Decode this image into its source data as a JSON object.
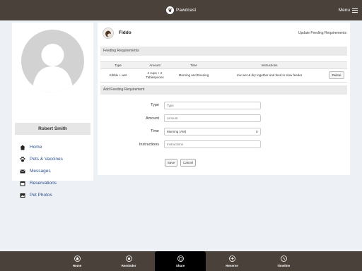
{
  "header": {
    "app_name": "Pawdcast",
    "logo_icon": "paw-logo-icon",
    "menu_label": "Menu"
  },
  "sidebar": {
    "username": "Robert Smith",
    "items": [
      {
        "label": "Home",
        "icon": "home-icon"
      },
      {
        "label": "Pets & Vaccines",
        "icon": "paw-icon"
      },
      {
        "label": "Messages",
        "icon": "envelope-icon"
      },
      {
        "label": "Reservations",
        "icon": "calendar-icon"
      },
      {
        "label": "Pet Photos",
        "icon": "photo-icon"
      }
    ]
  },
  "pet": {
    "name": "Fiddo",
    "update_link": "Update Feeding Requirements"
  },
  "feeding": {
    "section_title": "Feeding Requirements",
    "columns": [
      "Type",
      "Amount",
      "Time",
      "Instructions"
    ],
    "rows": [
      {
        "type": "Kibble + wet",
        "amount_line1": "2 cups + 2",
        "amount_line2": "Tablespoons",
        "time": "Morning and Evening",
        "instructions": "mix wet & dry together and feed in slow feeder",
        "delete_label": "Delete"
      }
    ]
  },
  "add_form": {
    "section_title": "Add Feeding Requirement",
    "type_label": "Type",
    "type_placeholder": "Type",
    "amount_label": "Amount",
    "amount_placeholder": "Amount",
    "time_label": "Time",
    "time_value": "Morning (AM)",
    "instructions_label": "Instructions",
    "instructions_placeholder": "Instructions",
    "save_label": "Save",
    "cancel_label": "Cancel"
  },
  "tabbar": {
    "active_tab": "Share",
    "tabs": [
      {
        "label": "Home",
        "icon": "home-circle-icon"
      },
      {
        "label": "Reminder",
        "icon": "reminder-icon"
      },
      {
        "label": "Share",
        "icon": "share-icon"
      },
      {
        "label": "Reserve",
        "icon": "plus-circle-icon"
      },
      {
        "label": "Timeline",
        "icon": "clock-icon"
      }
    ]
  },
  "colors": {
    "topbar": "#4b413b",
    "background": "#edf0f4",
    "nav_link": "#2e4f88",
    "active_tab": "#000000"
  }
}
